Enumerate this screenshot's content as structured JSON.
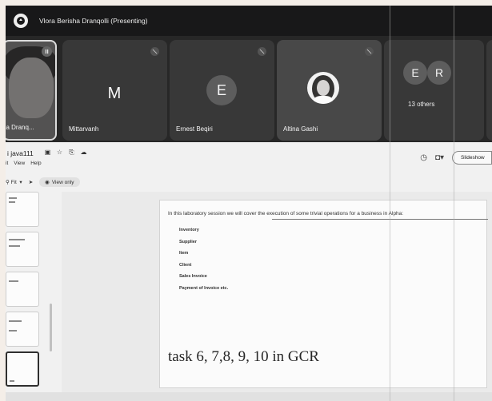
{
  "meet": {
    "presenter_label": "Vlora Berisha Dranqolli (Presenting)",
    "participants": [
      {
        "name": "ha Dranq...",
        "type": "video"
      },
      {
        "name": "Mittarvanh",
        "initial": "M",
        "type": "letter"
      },
      {
        "name": "Ernest Beqiri",
        "initial": "E",
        "type": "circle"
      },
      {
        "name": "Altina Gashi",
        "type": "photo"
      }
    ],
    "others": {
      "initials": [
        "E",
        "R"
      ],
      "label": "13 others"
    }
  },
  "slides": {
    "doc_title": "i java111",
    "menu": [
      "it",
      "View",
      "Help"
    ],
    "zoom": "Fit",
    "view_only": "View only",
    "slideshow": "Slideshow",
    "intro_text": "In this laboratory session we will cover the execution of some trivial operations for a business in Alpha:",
    "bullets": [
      "Inventory",
      "Supplier",
      "Item",
      "Client",
      "Sales Invoice",
      "Payment of Invoice etc."
    ],
    "task_text": "task 6, 7,8, 9, 10 in GCR"
  },
  "colors": {
    "meet_bg": "#2b2b2d",
    "tile_bg": "#3b3b3e",
    "slides_bg": "#ececec"
  }
}
